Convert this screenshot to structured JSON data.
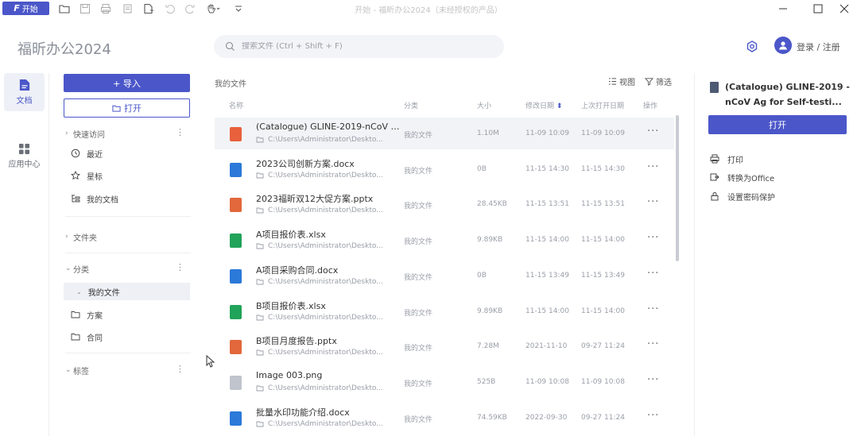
{
  "titlebar": {
    "start_label": "开始",
    "start_glyph": "F",
    "title": "开始 - 福昕办公2024（未经授权的产品）"
  },
  "header": {
    "logo": "福昕办公2024",
    "search_placeholder": "搜索文件 (Ctrl + Shift + F)",
    "login": "登录 / 注册"
  },
  "rail": {
    "items": [
      {
        "label": "文档",
        "icon": "document-icon",
        "active": true
      },
      {
        "label": "应用中心",
        "icon": "app-grid-icon",
        "active": false
      }
    ]
  },
  "sidebar": {
    "import_label": "+ 导入",
    "open_label": "打开",
    "quick_access": "快速访问",
    "recent": "最近",
    "starred": "星标",
    "my_docs": "我的文档",
    "folders": "文件夹",
    "category": "分类",
    "my_files": "我的文件",
    "scheme": "方案",
    "contract": "合同",
    "tags": "标签"
  },
  "main": {
    "title": "我的文件",
    "view_label": "视图",
    "filter_label": "筛选",
    "columns": {
      "name": "名称",
      "category": "分类",
      "size": "大小",
      "modified": "修改日期",
      "opened": "上次打开日期",
      "actions": "操作"
    },
    "files": [
      {
        "name": "(Catalogue) GLINE-2019-nCoV A...",
        "path": "C:\\Users\\Administrator\\Deskto...",
        "category": "我的文件",
        "size": "1.10M",
        "modified": "11-09 10:09",
        "opened": "11-09 10:09",
        "type": "pdf",
        "selected": true
      },
      {
        "name": "2023公司创新方案.docx",
        "path": "C:\\Users\\Administrator\\Deskto...",
        "category": "我的文件",
        "size": "0B",
        "modified": "11-15 14:30",
        "opened": "11-15 14:30",
        "type": "docx",
        "selected": false
      },
      {
        "name": "2023福昕双12大促方案.pptx",
        "path": "C:\\Users\\Administrator\\Deskto...",
        "category": "我的文件",
        "size": "28.45KB",
        "modified": "11-15 13:51",
        "opened": "11-15 13:51",
        "type": "pptx",
        "selected": false
      },
      {
        "name": "A项目报价表.xlsx",
        "path": "C:\\Users\\Administrator\\Deskto...",
        "category": "我的文件",
        "size": "9.89KB",
        "modified": "11-15 14:00",
        "opened": "11-15 14:00",
        "type": "xlsx",
        "selected": false
      },
      {
        "name": "A项目采购合同.docx",
        "path": "C:\\Users\\Administrator\\Deskto...",
        "category": "我的文件",
        "size": "0B",
        "modified": "11-15 13:49",
        "opened": "11-15 13:49",
        "type": "docx",
        "selected": false
      },
      {
        "name": "B项目报价表.xlsx",
        "path": "C:\\Users\\Administrator\\Deskto...",
        "category": "我的文件",
        "size": "9.89KB",
        "modified": "11-15 14:00",
        "opened": "11-15 14:00",
        "type": "xlsx",
        "selected": false
      },
      {
        "name": "B项目月度报告.pptx",
        "path": "C:\\Users\\Administrator\\Deskto...",
        "category": "我的文件",
        "size": "7.28M",
        "modified": "2021-11-10",
        "opened": "09-27 11:24",
        "type": "pptx",
        "selected": false
      },
      {
        "name": "Image 003.png",
        "path": "C:\\Users\\Administrator\\Deskto...",
        "category": "我的文件",
        "size": "525B",
        "modified": "11-09 10:08",
        "opened": "11-09 10:08",
        "type": "png",
        "selected": false
      },
      {
        "name": "批量水印功能介绍.docx",
        "path": "C:\\Users\\Administrator\\Deskto...",
        "category": "我的文件",
        "size": "74.59KB",
        "modified": "2022-09-30",
        "opened": "09-27 11:24",
        "type": "docx",
        "selected": false
      }
    ],
    "more_label": "···"
  },
  "right": {
    "title": "(Catalogue) GLINE-2019 -nCoV Ag for Self-testi...",
    "open_label": "打开",
    "actions": {
      "print": "打印",
      "convert": "转换为Office",
      "password": "设置密码保护"
    }
  },
  "colors": {
    "accent": "#4b57c9",
    "pdf": "#e8603c",
    "docx": "#2b79d8",
    "pptx": "#e2673a",
    "xlsx": "#22a35a",
    "png": "#c0c4cc"
  }
}
